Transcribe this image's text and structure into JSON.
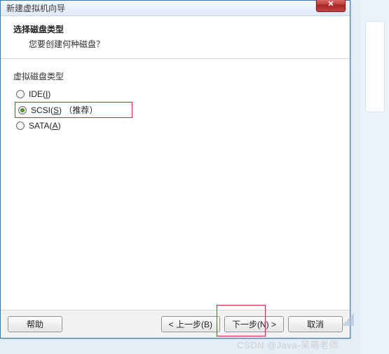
{
  "window": {
    "title": "新建虚拟机向导",
    "close_glyph": "✕"
  },
  "header": {
    "title": "选择磁盘类型",
    "subtitle": "您要创建何种磁盘？"
  },
  "group_label": "虚拟磁盘类型",
  "options": {
    "ide": {
      "prefix": "IDE(",
      "accel": "I",
      "suffix": ")"
    },
    "scsi": {
      "prefix": "SCSI(",
      "accel": "S",
      "suffix": ") （推荐）"
    },
    "sata": {
      "prefix": "SATA(",
      "accel": "A",
      "suffix": ")"
    }
  },
  "buttons": {
    "help": "帮助",
    "back": "< 上一步(B)",
    "next": "下一步(N) >",
    "cancel": "取消"
  },
  "watermark": "CSDN @Java-呆萌老师"
}
